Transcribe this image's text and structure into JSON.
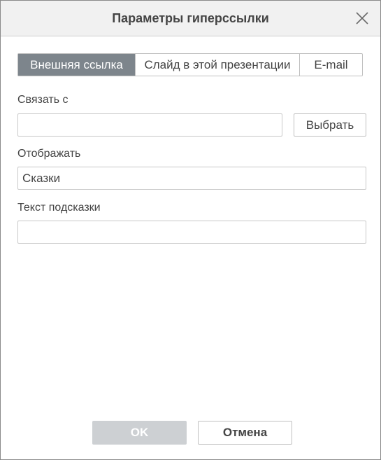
{
  "dialog": {
    "title": "Параметры гиперссылки"
  },
  "tabs": [
    {
      "label": "Внешняя ссылка",
      "active": true
    },
    {
      "label": "Слайд в этой презентации",
      "active": false
    },
    {
      "label": "E-mail",
      "active": false
    }
  ],
  "form": {
    "link_to_label": "Связать с",
    "link_to_value": "",
    "select_button": "Выбрать",
    "display_label": "Отображать",
    "display_value": "Сказки",
    "tooltip_label": "Текст подсказки",
    "tooltip_value": ""
  },
  "footer": {
    "ok_label": "OK",
    "cancel_label": "Отмена"
  },
  "colors": {
    "active_tab": "#7d858c",
    "ok_disabled": "#cdd0d3"
  }
}
